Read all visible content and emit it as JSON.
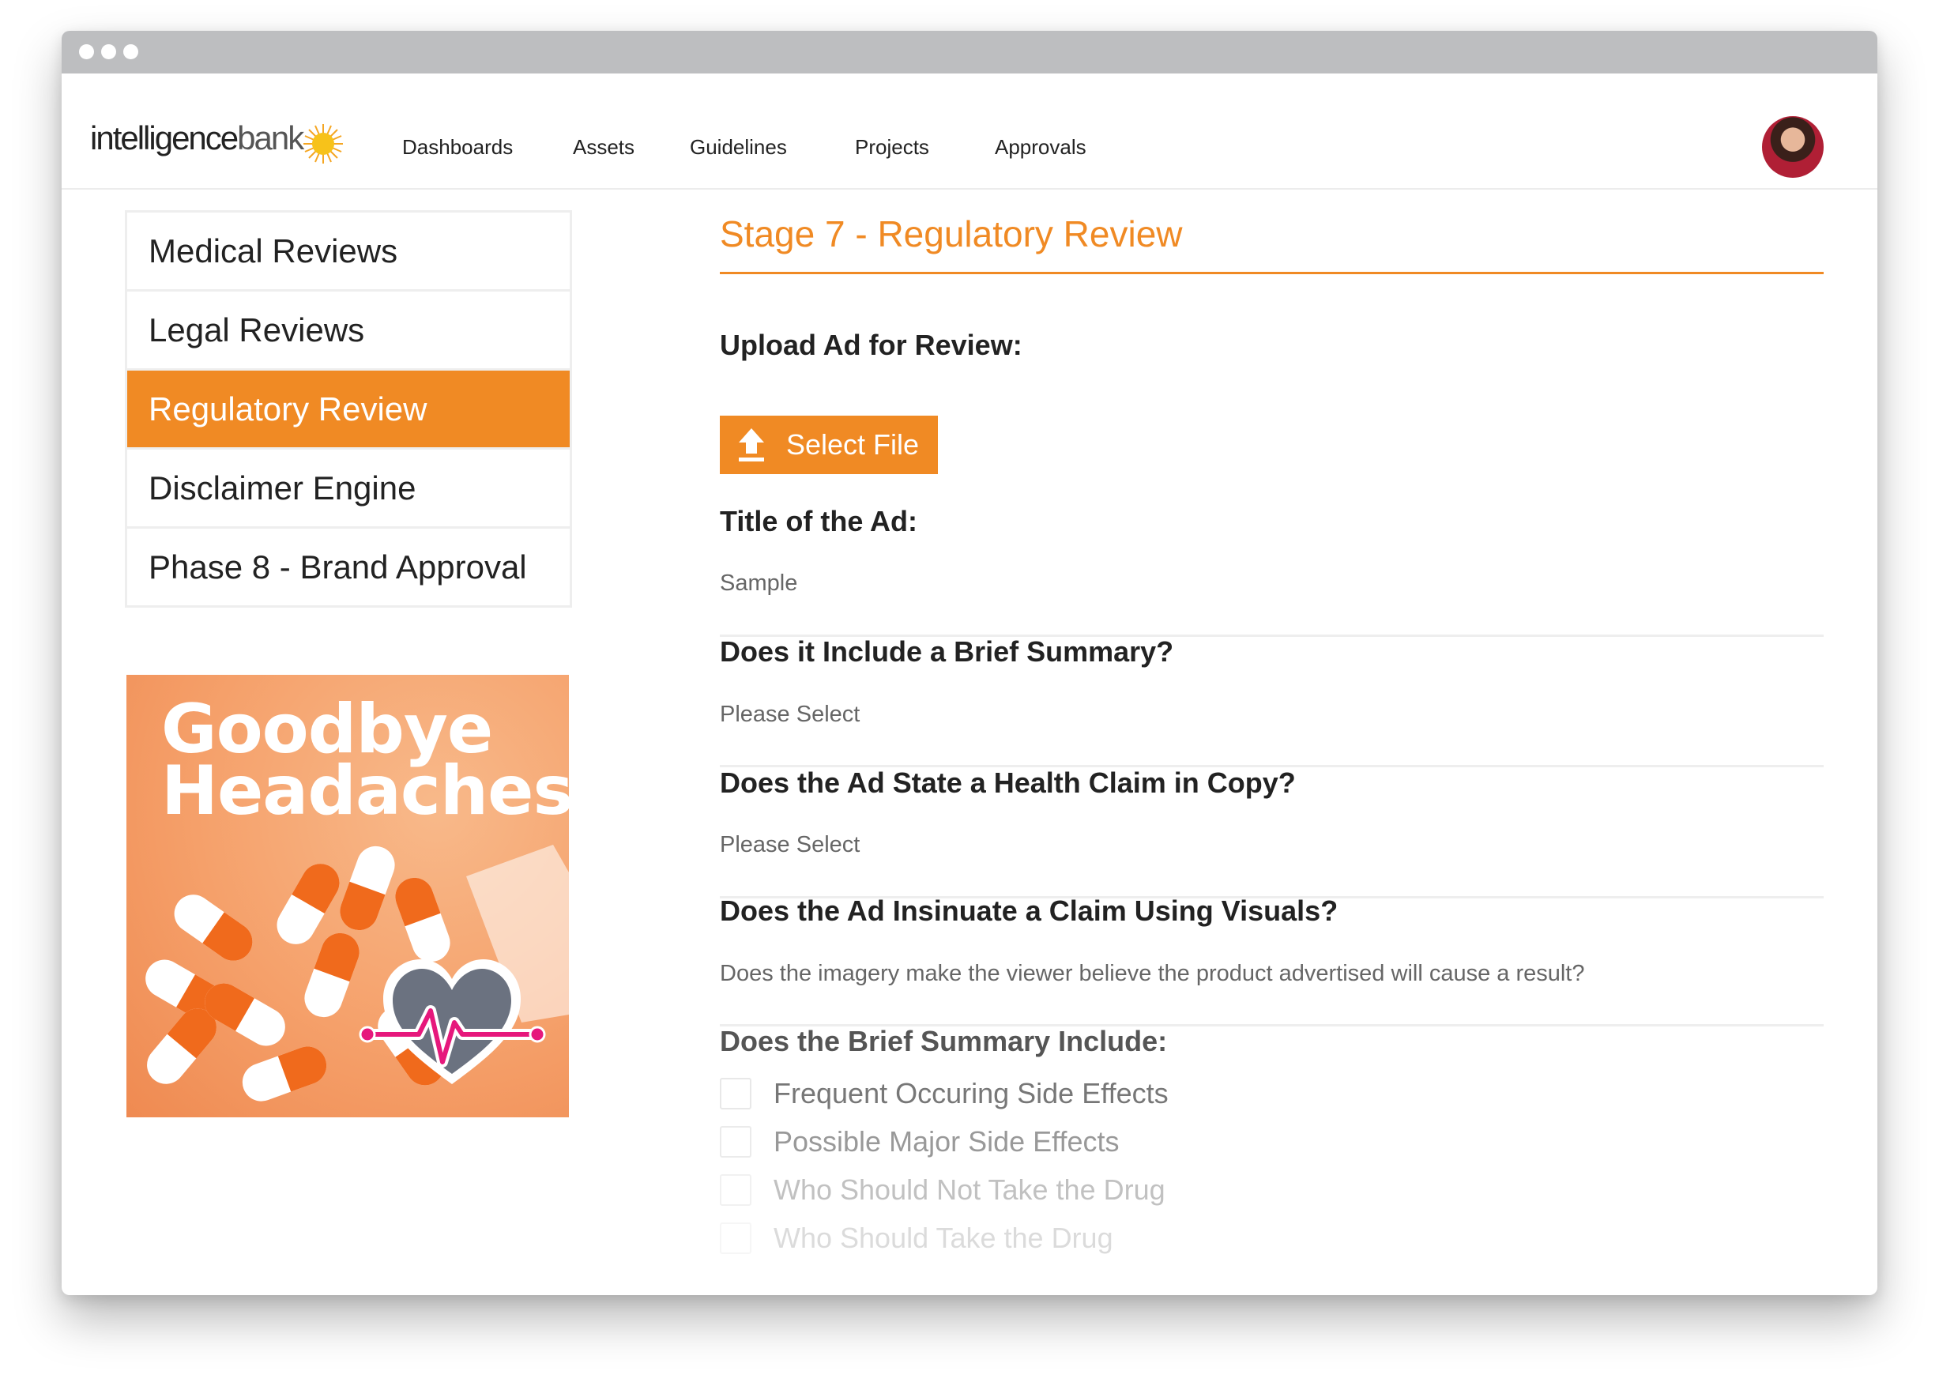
{
  "brand": {
    "logo_part1": "intelligence",
    "logo_part2": "bank",
    "accent": "#f08a24"
  },
  "nav": {
    "items": [
      "Dashboards",
      "Assets",
      "Guidelines",
      "Projects",
      "Approvals"
    ]
  },
  "sidebar": {
    "items": [
      {
        "label": "Medical Reviews",
        "active": false
      },
      {
        "label": "Legal Reviews",
        "active": false
      },
      {
        "label": "Regulatory Review",
        "active": true
      },
      {
        "label": "Disclaimer Engine",
        "active": false
      },
      {
        "label": "Phase 8 - Brand Approval",
        "active": false
      }
    ]
  },
  "promo": {
    "line1": "Goodbye",
    "line2": "Headaches"
  },
  "form": {
    "stage_title": "Stage 7 - Regulatory Review",
    "upload_label": "Upload Ad for Review:",
    "select_file": "Select File",
    "title_label": "Title of the Ad:",
    "title_value": "Sample",
    "brief_summary_label": "Does it Include a Brief Summary?",
    "brief_summary_value": "Please Select",
    "health_claim_label": "Does the Ad State a Health Claim in Copy?",
    "health_claim_value": "Please Select",
    "visual_claim_label": "Does the Ad Insinuate a Claim Using Visuals?",
    "visual_claim_placeholder": "Does the imagery make the viewer believe the product advertised will cause a result?",
    "includes_label": "Does the Brief Summary Include:",
    "checkboxes": [
      {
        "label": "Frequent Occuring Side Effects",
        "checked": false
      },
      {
        "label": "Possible Major Side Effects",
        "checked": false
      },
      {
        "label": "Who Should Not Take the Drug",
        "checked": false
      },
      {
        "label": "Who Should Take the Drug",
        "checked": false
      }
    ]
  }
}
